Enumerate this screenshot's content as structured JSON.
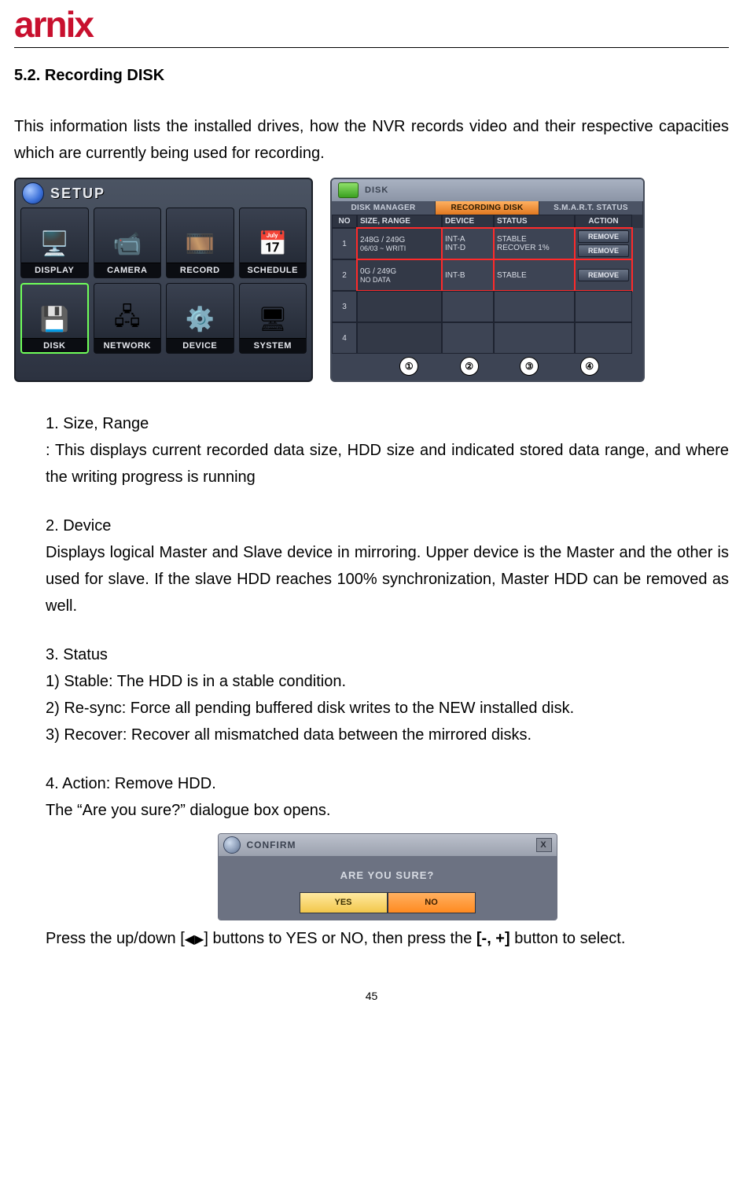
{
  "logo_text": "arnix",
  "section_heading": "5.2.  Recording  DISK",
  "intro": "This information lists the installed drives, how the NVR records video and their respective capacities which are currently being used for recording.",
  "setup": {
    "title": "SETUP",
    "items": [
      {
        "label": "DISPLAY",
        "icon": "🖥️"
      },
      {
        "label": "CAMERA",
        "icon": "📹"
      },
      {
        "label": "RECORD",
        "icon": "🎞️"
      },
      {
        "label": "SCHEDULE",
        "icon": "📅"
      },
      {
        "label": "DISK",
        "icon": "💾",
        "selected": true
      },
      {
        "label": "NETWORK",
        "icon": "🖧"
      },
      {
        "label": "DEVICE",
        "icon": "⚙️"
      },
      {
        "label": "SYSTEM",
        "icon": "🖥"
      }
    ]
  },
  "disk": {
    "title": "DISK",
    "tabs": [
      "DISK MANAGER",
      "RECORDING DISK",
      "S.M.A.R.T. STATUS"
    ],
    "active_tab": 1,
    "headers": {
      "no": "NO",
      "size": "SIZE, RANGE",
      "device": "DEVICE",
      "status": "STATUS",
      "action": "ACTION"
    },
    "rows": [
      {
        "no": "1",
        "size1": "248G / 249G",
        "size2": "06/03 ~ WRITI",
        "dev1": "INT-A",
        "dev2": "INT-D",
        "stat1": "STABLE",
        "stat2": "RECOVER 1%",
        "action": "REMOVE"
      },
      {
        "no": "2",
        "size1": "0G / 249G",
        "size2": "NO DATA",
        "dev1": "INT-B",
        "dev2": "",
        "stat1": "STABLE",
        "stat2": "",
        "action": "REMOVE"
      },
      {
        "no": "3",
        "size1": "",
        "size2": "",
        "dev1": "",
        "dev2": "",
        "stat1": "",
        "stat2": "",
        "action": ""
      },
      {
        "no": "4",
        "size1": "",
        "size2": "",
        "dev1": "",
        "dev2": "",
        "stat1": "",
        "stat2": "",
        "action": ""
      }
    ],
    "callouts": [
      "①",
      "②",
      "③",
      "④"
    ]
  },
  "list": {
    "i1_title": "1.  Size, Range",
    "i1_body": ": This displays current recorded data size, HDD size and indicated stored data range, and where the writing progress is running",
    "i2_title": "2.  Device",
    "i2_body": "Displays logical Master and Slave device in mirroring. Upper device is the Master and the other is used for slave. If the slave HDD reaches 100% synchronization, Master HDD can be removed as well.",
    "i3_title": "3.  Status",
    "i3_s1": "1) Stable: The HDD is in a stable condition.",
    "i3_s2": "2) Re-sync: Force all pending buffered disk writes to the NEW installed disk.",
    "i3_s3": "3) Recover: Recover all mismatched data between the mirrored disks.",
    "i4_title": "4.  Action: Remove HDD.",
    "i4_body": "The “Are you sure?” dialogue box opens."
  },
  "confirm": {
    "title": "CONFIRM",
    "close": "X",
    "message": "ARE YOU SURE?",
    "yes": "YES",
    "no": "NO"
  },
  "press_line_pre": "Press the up/down [",
  "press_line_arrows": "◀▶",
  "press_line_mid": "] buttons to YES or NO, then press the ",
  "press_line_bold": "[-, +]",
  "press_line_post": " button to select.",
  "page_number": "45"
}
